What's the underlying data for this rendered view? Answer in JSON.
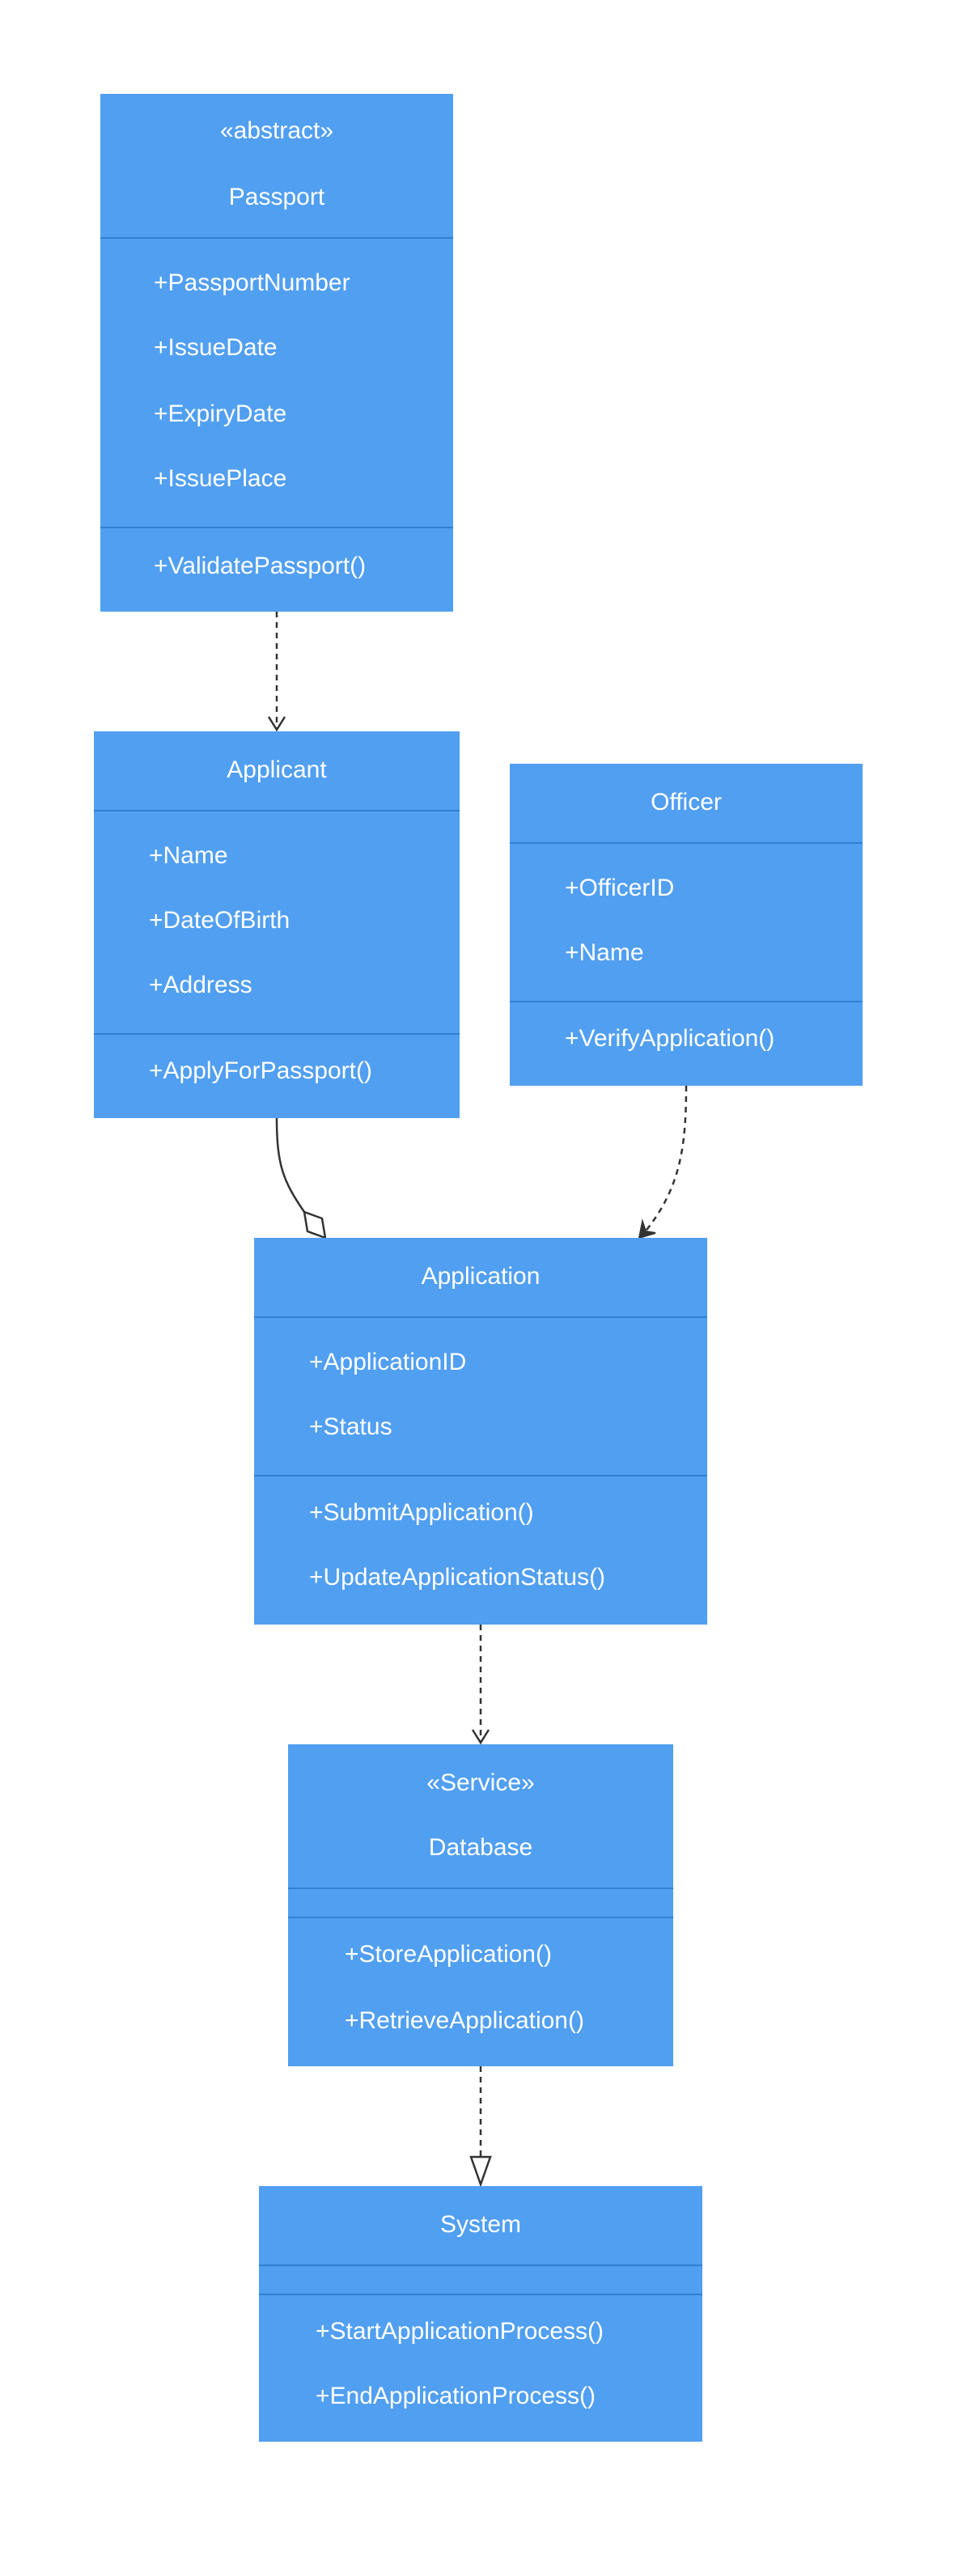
{
  "classes": {
    "passport": {
      "stereotype": "«abstract»",
      "name": "Passport",
      "attributes": [
        "+PassportNumber",
        "+IssueDate",
        "+ExpiryDate",
        "+IssuePlace"
      ],
      "methods": [
        "+ValidatePassport()"
      ]
    },
    "applicant": {
      "name": "Applicant",
      "attributes": [
        "+Name",
        "+DateOfBirth",
        "+Address"
      ],
      "methods": [
        "+ApplyForPassport()"
      ]
    },
    "officer": {
      "name": "Officer",
      "attributes": [
        "+OfficerID",
        "+Name"
      ],
      "methods": [
        "+VerifyApplication()"
      ]
    },
    "application": {
      "name": "Application",
      "attributes": [
        "+ApplicationID",
        "+Status"
      ],
      "methods": [
        "+SubmitApplication()",
        "+UpdateApplicationStatus()"
      ]
    },
    "database": {
      "stereotype": "«Service»",
      "name": "Database",
      "attributes": [],
      "methods": [
        "+StoreApplication()",
        "+RetrieveApplication()"
      ]
    },
    "system": {
      "name": "System",
      "attributes": [],
      "methods": [
        "+StartApplicationProcess()",
        "+EndApplicationProcess()"
      ]
    }
  },
  "relations": [
    {
      "from": "passport",
      "to": "applicant",
      "type": "dependency"
    },
    {
      "from": "applicant",
      "to": "application",
      "type": "aggregation"
    },
    {
      "from": "officer",
      "to": "application",
      "type": "dependency"
    },
    {
      "from": "application",
      "to": "database",
      "type": "dependency"
    },
    {
      "from": "database",
      "to": "system",
      "type": "realization"
    }
  ],
  "colors": {
    "class_fill": "#519ff0",
    "divider": "#2f80d6",
    "text": "#ffffff",
    "edge": "#333333"
  }
}
